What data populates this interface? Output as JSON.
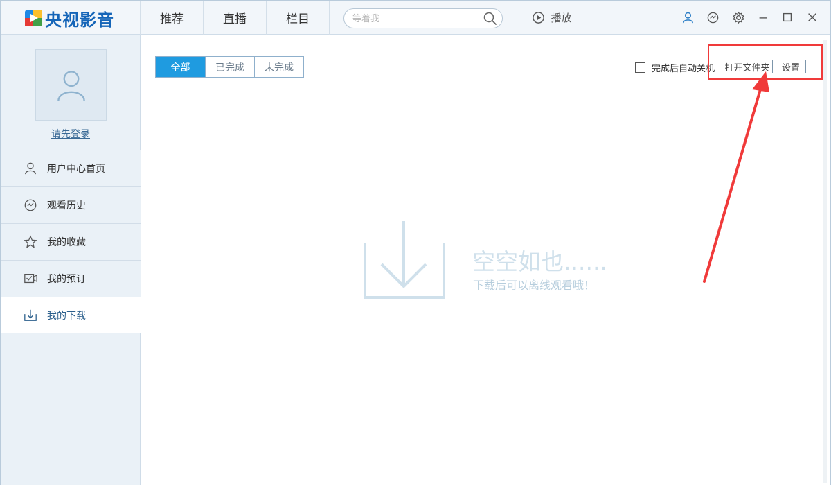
{
  "app": {
    "logo_text": "央视影音",
    "brand_colors": {
      "accent": "#1f9be0",
      "logo_blue": "#1565b8",
      "highlight": "#f03a3a"
    }
  },
  "topnav": {
    "tabs": [
      {
        "label": "推荐"
      },
      {
        "label": "直播"
      },
      {
        "label": "栏目"
      }
    ],
    "search": {
      "placeholder": "等着我",
      "icon": "search-icon"
    },
    "play_label": "播放",
    "window_icons": [
      "user-icon",
      "message-icon",
      "gear-icon",
      "minimize-icon",
      "maximize-icon",
      "close-icon"
    ]
  },
  "sidebar": {
    "login_label": "请先登录",
    "items": [
      {
        "label": "用户中心首页",
        "icon": "user-icon"
      },
      {
        "label": "观看历史",
        "icon": "history-icon"
      },
      {
        "label": "我的收藏",
        "icon": "star-icon"
      },
      {
        "label": "我的预订",
        "icon": "reservation-icon"
      },
      {
        "label": "我的下载",
        "icon": "download-icon",
        "active": true
      }
    ]
  },
  "main": {
    "filters": [
      {
        "label": "全部",
        "active": true
      },
      {
        "label": "已完成"
      },
      {
        "label": "未完成"
      }
    ],
    "auto_shutdown_label": "完成后自动关机",
    "open_folder_label": "打开文件夹",
    "settings_label": "设置",
    "empty_title": "空空如也......",
    "empty_subtitle": "下载后可以离线观看哦！"
  }
}
